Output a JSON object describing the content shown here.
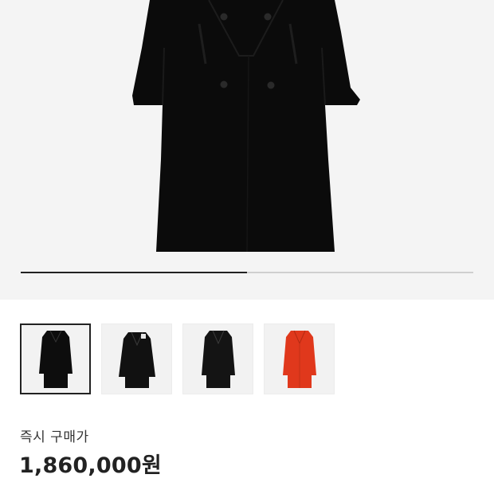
{
  "product": {
    "colors": {
      "background": "#f4f4f4",
      "coat_black": "#0b0b0b",
      "coat_red": "#e0381c",
      "text_dark": "#222222",
      "progress_active": "#222222",
      "progress_track": "#cfcfcf"
    },
    "carousel": {
      "progress_fraction": 0.5
    },
    "thumbnails": [
      {
        "variant": "black",
        "selected": true
      },
      {
        "variant": "black",
        "selected": false
      },
      {
        "variant": "black",
        "selected": false
      },
      {
        "variant": "red",
        "selected": false
      }
    ],
    "price": {
      "label": "즉시 구매가",
      "value": "1,860,000원"
    }
  }
}
